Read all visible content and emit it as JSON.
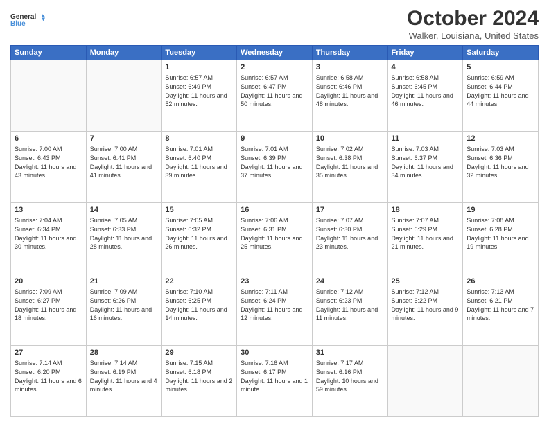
{
  "logo": {
    "line1": "General",
    "line2": "Blue"
  },
  "header": {
    "month": "October 2024",
    "location": "Walker, Louisiana, United States"
  },
  "weekdays": [
    "Sunday",
    "Monday",
    "Tuesday",
    "Wednesday",
    "Thursday",
    "Friday",
    "Saturday"
  ],
  "weeks": [
    [
      {
        "day": "",
        "sunrise": "",
        "sunset": "",
        "daylight": ""
      },
      {
        "day": "",
        "sunrise": "",
        "sunset": "",
        "daylight": ""
      },
      {
        "day": "1",
        "sunrise": "Sunrise: 6:57 AM",
        "sunset": "Sunset: 6:49 PM",
        "daylight": "Daylight: 11 hours and 52 minutes."
      },
      {
        "day": "2",
        "sunrise": "Sunrise: 6:57 AM",
        "sunset": "Sunset: 6:47 PM",
        "daylight": "Daylight: 11 hours and 50 minutes."
      },
      {
        "day": "3",
        "sunrise": "Sunrise: 6:58 AM",
        "sunset": "Sunset: 6:46 PM",
        "daylight": "Daylight: 11 hours and 48 minutes."
      },
      {
        "day": "4",
        "sunrise": "Sunrise: 6:58 AM",
        "sunset": "Sunset: 6:45 PM",
        "daylight": "Daylight: 11 hours and 46 minutes."
      },
      {
        "day": "5",
        "sunrise": "Sunrise: 6:59 AM",
        "sunset": "Sunset: 6:44 PM",
        "daylight": "Daylight: 11 hours and 44 minutes."
      }
    ],
    [
      {
        "day": "6",
        "sunrise": "Sunrise: 7:00 AM",
        "sunset": "Sunset: 6:43 PM",
        "daylight": "Daylight: 11 hours and 43 minutes."
      },
      {
        "day": "7",
        "sunrise": "Sunrise: 7:00 AM",
        "sunset": "Sunset: 6:41 PM",
        "daylight": "Daylight: 11 hours and 41 minutes."
      },
      {
        "day": "8",
        "sunrise": "Sunrise: 7:01 AM",
        "sunset": "Sunset: 6:40 PM",
        "daylight": "Daylight: 11 hours and 39 minutes."
      },
      {
        "day": "9",
        "sunrise": "Sunrise: 7:01 AM",
        "sunset": "Sunset: 6:39 PM",
        "daylight": "Daylight: 11 hours and 37 minutes."
      },
      {
        "day": "10",
        "sunrise": "Sunrise: 7:02 AM",
        "sunset": "Sunset: 6:38 PM",
        "daylight": "Daylight: 11 hours and 35 minutes."
      },
      {
        "day": "11",
        "sunrise": "Sunrise: 7:03 AM",
        "sunset": "Sunset: 6:37 PM",
        "daylight": "Daylight: 11 hours and 34 minutes."
      },
      {
        "day": "12",
        "sunrise": "Sunrise: 7:03 AM",
        "sunset": "Sunset: 6:36 PM",
        "daylight": "Daylight: 11 hours and 32 minutes."
      }
    ],
    [
      {
        "day": "13",
        "sunrise": "Sunrise: 7:04 AM",
        "sunset": "Sunset: 6:34 PM",
        "daylight": "Daylight: 11 hours and 30 minutes."
      },
      {
        "day": "14",
        "sunrise": "Sunrise: 7:05 AM",
        "sunset": "Sunset: 6:33 PM",
        "daylight": "Daylight: 11 hours and 28 minutes."
      },
      {
        "day": "15",
        "sunrise": "Sunrise: 7:05 AM",
        "sunset": "Sunset: 6:32 PM",
        "daylight": "Daylight: 11 hours and 26 minutes."
      },
      {
        "day": "16",
        "sunrise": "Sunrise: 7:06 AM",
        "sunset": "Sunset: 6:31 PM",
        "daylight": "Daylight: 11 hours and 25 minutes."
      },
      {
        "day": "17",
        "sunrise": "Sunrise: 7:07 AM",
        "sunset": "Sunset: 6:30 PM",
        "daylight": "Daylight: 11 hours and 23 minutes."
      },
      {
        "day": "18",
        "sunrise": "Sunrise: 7:07 AM",
        "sunset": "Sunset: 6:29 PM",
        "daylight": "Daylight: 11 hours and 21 minutes."
      },
      {
        "day": "19",
        "sunrise": "Sunrise: 7:08 AM",
        "sunset": "Sunset: 6:28 PM",
        "daylight": "Daylight: 11 hours and 19 minutes."
      }
    ],
    [
      {
        "day": "20",
        "sunrise": "Sunrise: 7:09 AM",
        "sunset": "Sunset: 6:27 PM",
        "daylight": "Daylight: 11 hours and 18 minutes."
      },
      {
        "day": "21",
        "sunrise": "Sunrise: 7:09 AM",
        "sunset": "Sunset: 6:26 PM",
        "daylight": "Daylight: 11 hours and 16 minutes."
      },
      {
        "day": "22",
        "sunrise": "Sunrise: 7:10 AM",
        "sunset": "Sunset: 6:25 PM",
        "daylight": "Daylight: 11 hours and 14 minutes."
      },
      {
        "day": "23",
        "sunrise": "Sunrise: 7:11 AM",
        "sunset": "Sunset: 6:24 PM",
        "daylight": "Daylight: 11 hours and 12 minutes."
      },
      {
        "day": "24",
        "sunrise": "Sunrise: 7:12 AM",
        "sunset": "Sunset: 6:23 PM",
        "daylight": "Daylight: 11 hours and 11 minutes."
      },
      {
        "day": "25",
        "sunrise": "Sunrise: 7:12 AM",
        "sunset": "Sunset: 6:22 PM",
        "daylight": "Daylight: 11 hours and 9 minutes."
      },
      {
        "day": "26",
        "sunrise": "Sunrise: 7:13 AM",
        "sunset": "Sunset: 6:21 PM",
        "daylight": "Daylight: 11 hours and 7 minutes."
      }
    ],
    [
      {
        "day": "27",
        "sunrise": "Sunrise: 7:14 AM",
        "sunset": "Sunset: 6:20 PM",
        "daylight": "Daylight: 11 hours and 6 minutes."
      },
      {
        "day": "28",
        "sunrise": "Sunrise: 7:14 AM",
        "sunset": "Sunset: 6:19 PM",
        "daylight": "Daylight: 11 hours and 4 minutes."
      },
      {
        "day": "29",
        "sunrise": "Sunrise: 7:15 AM",
        "sunset": "Sunset: 6:18 PM",
        "daylight": "Daylight: 11 hours and 2 minutes."
      },
      {
        "day": "30",
        "sunrise": "Sunrise: 7:16 AM",
        "sunset": "Sunset: 6:17 PM",
        "daylight": "Daylight: 11 hours and 1 minute."
      },
      {
        "day": "31",
        "sunrise": "Sunrise: 7:17 AM",
        "sunset": "Sunset: 6:16 PM",
        "daylight": "Daylight: 10 hours and 59 minutes."
      },
      {
        "day": "",
        "sunrise": "",
        "sunset": "",
        "daylight": ""
      },
      {
        "day": "",
        "sunrise": "",
        "sunset": "",
        "daylight": ""
      }
    ]
  ]
}
